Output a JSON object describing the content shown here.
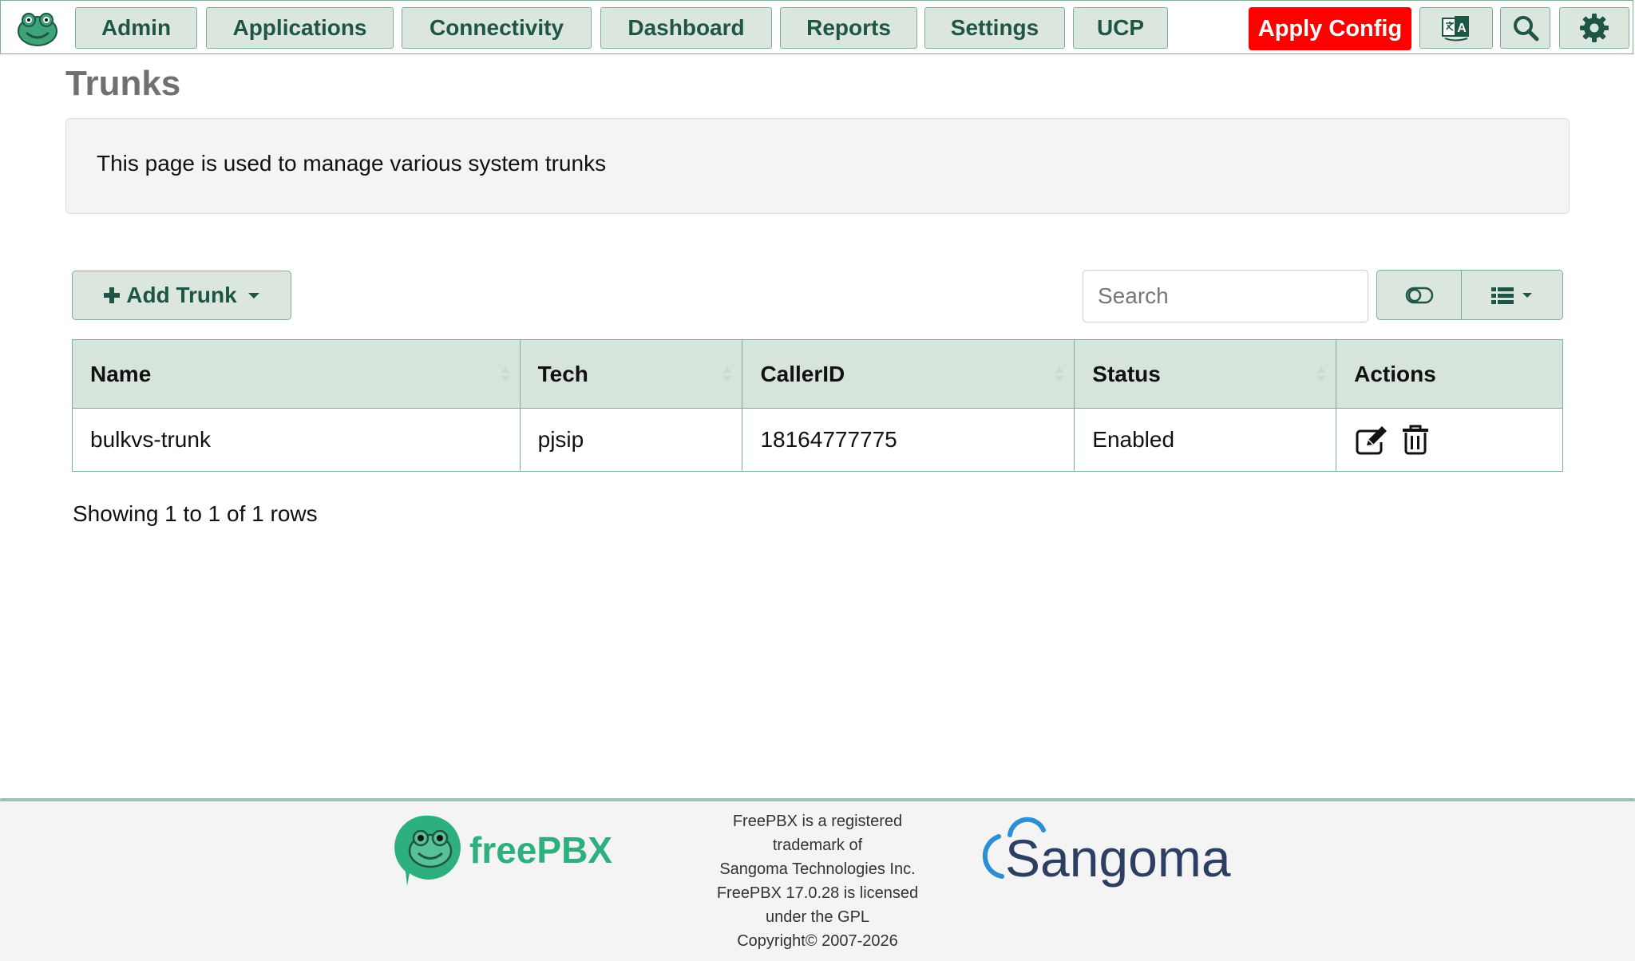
{
  "nav": {
    "items": [
      {
        "label": "Admin"
      },
      {
        "label": "Applications"
      },
      {
        "label": "Connectivity"
      },
      {
        "label": "Dashboard"
      },
      {
        "label": "Reports"
      },
      {
        "label": "Settings"
      },
      {
        "label": "UCP"
      }
    ],
    "apply_label": "Apply Config"
  },
  "page": {
    "title": "Trunks",
    "description": "This page is used to manage various system trunks"
  },
  "toolbar": {
    "add_label": "Add Trunk",
    "search_placeholder": "Search"
  },
  "table": {
    "columns": [
      "Name",
      "Tech",
      "CallerID",
      "Status",
      "Actions"
    ],
    "rows": [
      {
        "name": "bulkvs-trunk",
        "tech": "pjsip",
        "callerid": "18164777775",
        "status": "Enabled"
      }
    ],
    "rows_info": "Showing 1 to 1 of 1 rows"
  },
  "footer": {
    "brand_name": "freePBX",
    "legal_lines": [
      "FreePBX is a registered",
      "trademark of",
      "Sangoma Technologies Inc.",
      "FreePBX 17.0.28 is licensed",
      "under the GPL",
      "Copyright© 2007-2026"
    ],
    "partner_name": "Sangoma"
  },
  "colors": {
    "accent": "#1f5545",
    "button_bg": "#dbe6df",
    "border": "#7fae97",
    "apply": "#ff0000",
    "freepbx_green": "#2db07d",
    "sangoma_blue": "#2b8fd6",
    "sangoma_dark": "#2d3e63"
  }
}
